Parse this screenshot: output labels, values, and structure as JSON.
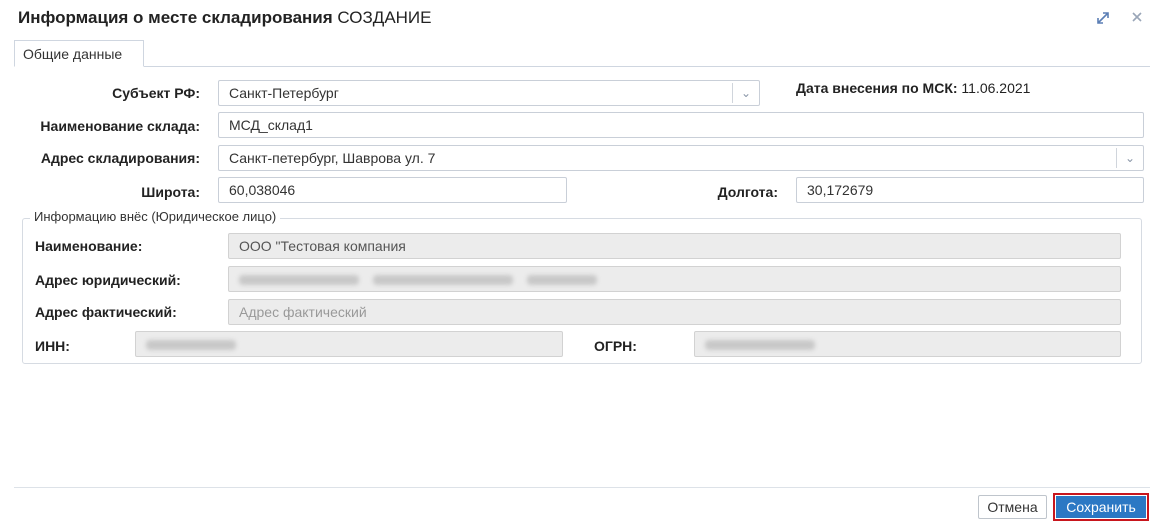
{
  "window": {
    "title_bold": "Информация о месте складирования",
    "title_mode": "СОЗДАНИЕ",
    "expand_icon": "expand-icon",
    "close_icon": "close-icon"
  },
  "tabs": [
    {
      "label": "Общие данные",
      "active": true
    }
  ],
  "form": {
    "subject_label": "Субъект РФ:",
    "subject_value": "Санкт-Петербург",
    "date_label": "Дата внесения по МСК:",
    "date_value": "11.06.2021",
    "warehouse_name_label": "Наименование склада:",
    "warehouse_name_value": "МСД_склад1",
    "storage_address_label": "Адрес складирования:",
    "storage_address_value": "Санкт-петербург, Шаврова ул. 7",
    "latitude_label": "Широта:",
    "latitude_value": "60,038046",
    "longitude_label": "Долгота:",
    "longitude_value": "30,172679"
  },
  "entered_by": {
    "legend": "Информацию внёс (Юридическое лицо)",
    "name_label": "Наименование:",
    "name_value": "ООО \"Тестовая компания",
    "legal_address_label": "Адрес юридический:",
    "actual_address_label": "Адрес фактический:",
    "actual_address_placeholder": "Адрес фактический",
    "inn_label": "ИНН:",
    "ogrn_label": "ОГРН:"
  },
  "footer": {
    "cancel_label": "Отмена",
    "save_label": "Сохранить"
  },
  "colors": {
    "save_button": "#2b78c4",
    "save_highlight": "#c8161d"
  }
}
